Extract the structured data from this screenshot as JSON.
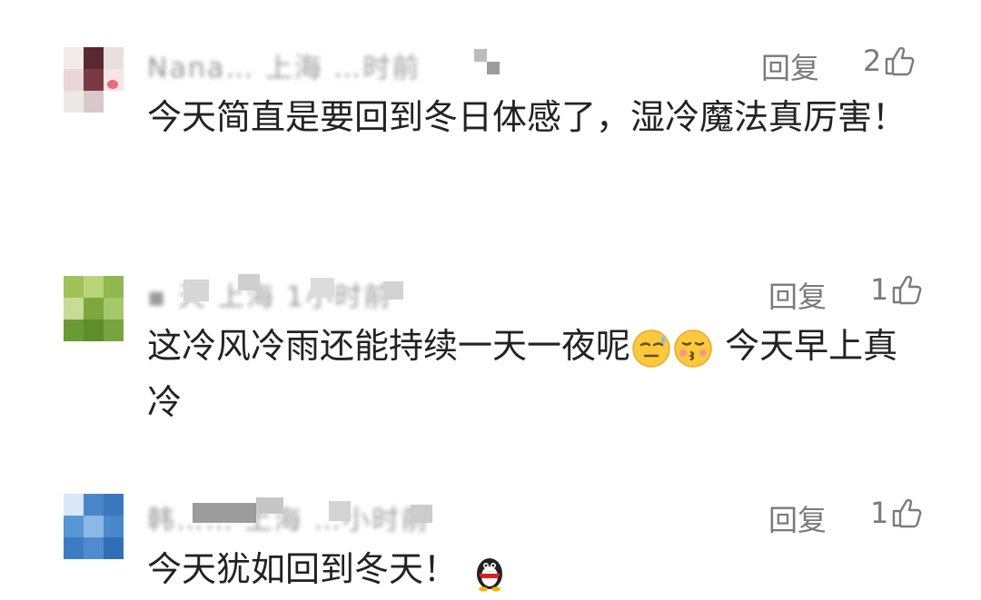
{
  "comments": [
    {
      "meta": "Nana… 上海 …时前",
      "reply_label": "回复",
      "likes": "2",
      "text": "今天简直是要回到冬日体感了，湿冷魔法真厉害！"
    },
    {
      "meta": "▪ 天 上海 1小时前",
      "reply_label": "回复",
      "likes": "1",
      "text_before_emoji": "这冷风冷雨还能持续一天一夜呢",
      "text_after_emoji": " 今天早上真冷",
      "emojis": [
        "sweat-smile-emoji",
        "kiss-emoji"
      ]
    },
    {
      "meta": "韩…… 上海 …小时前",
      "reply_label": "回复",
      "likes": "1",
      "text": "今天犹如回到冬天！",
      "emojis": [
        "qq-penguin-emoji"
      ]
    }
  ],
  "colors": {
    "text": "#222222",
    "meta": "#9a9a9a",
    "action": "#7a7a7a",
    "background": "#ffffff"
  }
}
